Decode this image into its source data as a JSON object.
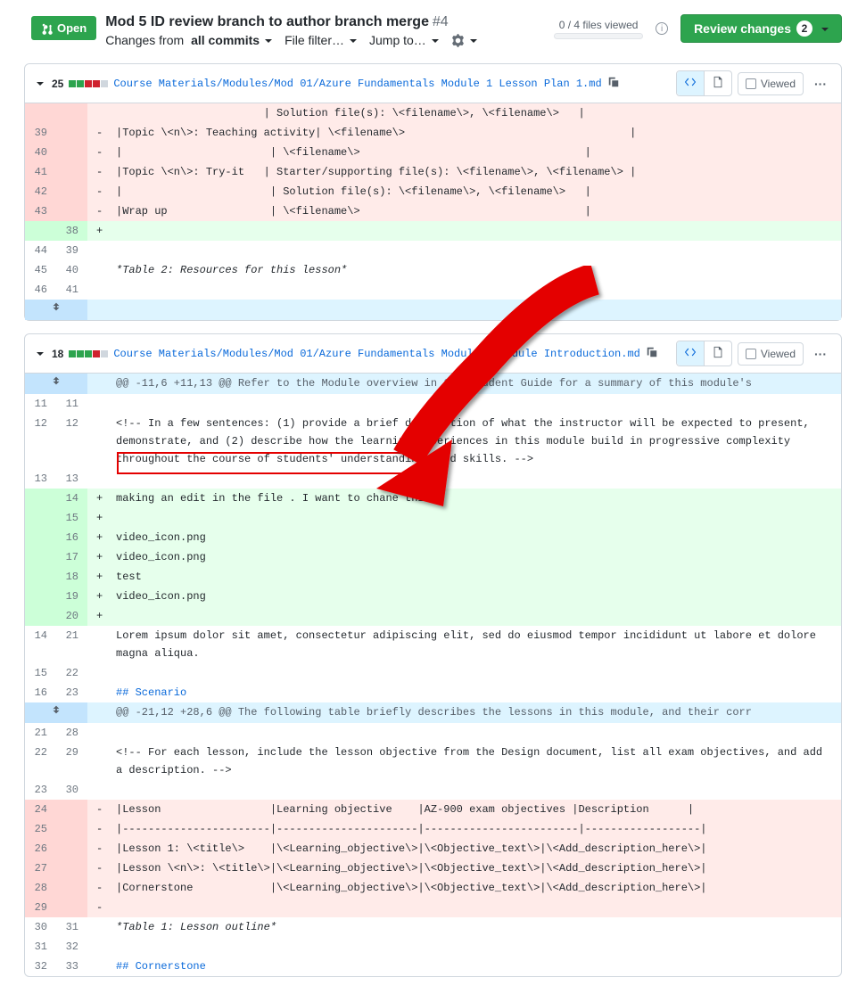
{
  "pr": {
    "state": "Open",
    "title": "Mod 5 ID review branch to author branch merge",
    "number": "#4"
  },
  "filters": {
    "changes_from_label": "Changes from",
    "changes_from_value": "all commits",
    "file_filter": "File filter…",
    "jump_to": "Jump to…"
  },
  "progress": {
    "text": "0 / 4 files viewed"
  },
  "review_btn": {
    "label": "Review changes",
    "count": "2"
  },
  "toggle": {
    "viewed_label": "Viewed"
  },
  "files": [
    {
      "path": "Course Materials/Modules/Mod 01/Azure Fundamentals Module 1 Lesson Plan 1.md",
      "adds": "25",
      "rows": [
        {
          "t": "delbar",
          "ol": "",
          "nl": "",
          "m": "",
          "c": "                       | Solution file(s): \\<filename\\>, \\<filename\\>   |"
        },
        {
          "t": "del",
          "ol": "39",
          "nl": "",
          "m": "-",
          "c": "|Topic \\<n\\>: Teaching activity| \\<filename\\>                                   |"
        },
        {
          "t": "del",
          "ol": "40",
          "nl": "",
          "m": "-",
          "c": "|                       | \\<filename\\>                                   |"
        },
        {
          "t": "del",
          "ol": "41",
          "nl": "",
          "m": "-",
          "c": "|Topic \\<n\\>: Try-it   | Starter/supporting file(s): \\<filename\\>, \\<filename\\> |"
        },
        {
          "t": "del",
          "ol": "42",
          "nl": "",
          "m": "-",
          "c": "|                       | Solution file(s): \\<filename\\>, \\<filename\\>   |"
        },
        {
          "t": "del",
          "ol": "43",
          "nl": "",
          "m": "-",
          "c": "|Wrap up                | \\<filename\\>                                   |"
        },
        {
          "t": "add",
          "ol": "",
          "nl": "38",
          "m": "+",
          "c": ""
        },
        {
          "t": "ctx",
          "ol": "44",
          "nl": "39",
          "m": "",
          "c": ""
        },
        {
          "t": "ctx",
          "ol": "45",
          "nl": "40",
          "m": "",
          "c": "*Table 2: Resources for this lesson*",
          "italic": true
        },
        {
          "t": "ctx",
          "ol": "46",
          "nl": "41",
          "m": "",
          "c": ""
        },
        {
          "t": "expand"
        }
      ]
    },
    {
      "path": "Course Materials/Modules/Mod 01/Azure Fundamentals Module 1 Module Introduction.md",
      "adds": "18",
      "rows": [
        {
          "t": "hunk",
          "c": "@@ -11,6 +11,13 @@ Refer to the Module overview in the Student Guide for a summary of this module's"
        },
        {
          "t": "ctx",
          "ol": "11",
          "nl": "11",
          "m": "",
          "c": ""
        },
        {
          "t": "ctx",
          "ol": "12",
          "nl": "12",
          "m": "",
          "c": "<!-- In a few sentences: (1) provide a brief description of what the instructor will be expected to present, demonstrate, and (2) describe how the learning experiences in this module build in progressive complexity throughout the course of students' understandings and skills. -->"
        },
        {
          "t": "ctx",
          "ol": "13",
          "nl": "13",
          "m": "",
          "c": ""
        },
        {
          "t": "add",
          "ol": "",
          "nl": "14",
          "m": "+",
          "c": "making an edit in the file . I want to chane this"
        },
        {
          "t": "add",
          "ol": "",
          "nl": "15",
          "m": "+",
          "c": ""
        },
        {
          "t": "add",
          "ol": "",
          "nl": "16",
          "m": "+",
          "c": "video_icon.png"
        },
        {
          "t": "add",
          "ol": "",
          "nl": "17",
          "m": "+",
          "c": "video_icon.png"
        },
        {
          "t": "add",
          "ol": "",
          "nl": "18",
          "m": "+",
          "c": "test"
        },
        {
          "t": "add",
          "ol": "",
          "nl": "19",
          "m": "+",
          "c": "video_icon.png"
        },
        {
          "t": "add",
          "ol": "",
          "nl": "20",
          "m": "+",
          "c": ""
        },
        {
          "t": "ctx",
          "ol": "14",
          "nl": "21",
          "m": "",
          "c": "Lorem ipsum dolor sit amet, consectetur adipiscing elit, sed do eiusmod tempor incididunt ut labore et dolore magna aliqua."
        },
        {
          "t": "ctx",
          "ol": "15",
          "nl": "22",
          "m": "",
          "c": ""
        },
        {
          "t": "ctx",
          "ol": "16",
          "nl": "23",
          "m": "",
          "c": "## Scenario",
          "blue": true
        },
        {
          "t": "hunk",
          "c": "@@ -21,12 +28,6 @@ The following table briefly describes the lessons in this module, and their corr"
        },
        {
          "t": "ctx",
          "ol": "21",
          "nl": "28",
          "m": "",
          "c": ""
        },
        {
          "t": "ctx",
          "ol": "22",
          "nl": "29",
          "m": "",
          "c": "<!-- For each lesson, include the lesson objective from the Design document, list all exam objectives, and add a description. -->"
        },
        {
          "t": "ctx",
          "ol": "23",
          "nl": "30",
          "m": "",
          "c": ""
        },
        {
          "t": "del",
          "ol": "24",
          "nl": "",
          "m": "-",
          "c": "|Lesson                 |Learning objective    |AZ-900 exam objectives |Description      |"
        },
        {
          "t": "del",
          "ol": "25",
          "nl": "",
          "m": "-",
          "c": "|-----------------------|----------------------|------------------------|------------------|"
        },
        {
          "t": "del",
          "ol": "26",
          "nl": "",
          "m": "-",
          "c": "|Lesson 1: \\<title\\>    |\\<Learning_objective\\>|\\<Objective_text\\>|\\<Add_description_here\\>|"
        },
        {
          "t": "del",
          "ol": "27",
          "nl": "",
          "m": "-",
          "c": "|Lesson \\<n\\>: \\<title\\>|\\<Learning_objective\\>|\\<Objective_text\\>|\\<Add_description_here\\>|"
        },
        {
          "t": "del",
          "ol": "28",
          "nl": "",
          "m": "-",
          "c": "|Cornerstone            |\\<Learning_objective\\>|\\<Objective_text\\>|\\<Add_description_here\\>|"
        },
        {
          "t": "del",
          "ol": "29",
          "nl": "",
          "m": "-",
          "c": ""
        },
        {
          "t": "ctx",
          "ol": "30",
          "nl": "31",
          "m": "",
          "c": "*Table 1: Lesson outline*",
          "italic": true
        },
        {
          "t": "ctx",
          "ol": "31",
          "nl": "32",
          "m": "",
          "c": ""
        },
        {
          "t": "ctx",
          "ol": "32",
          "nl": "33",
          "m": "",
          "c": "## Cornerstone",
          "blue": true
        }
      ]
    }
  ]
}
